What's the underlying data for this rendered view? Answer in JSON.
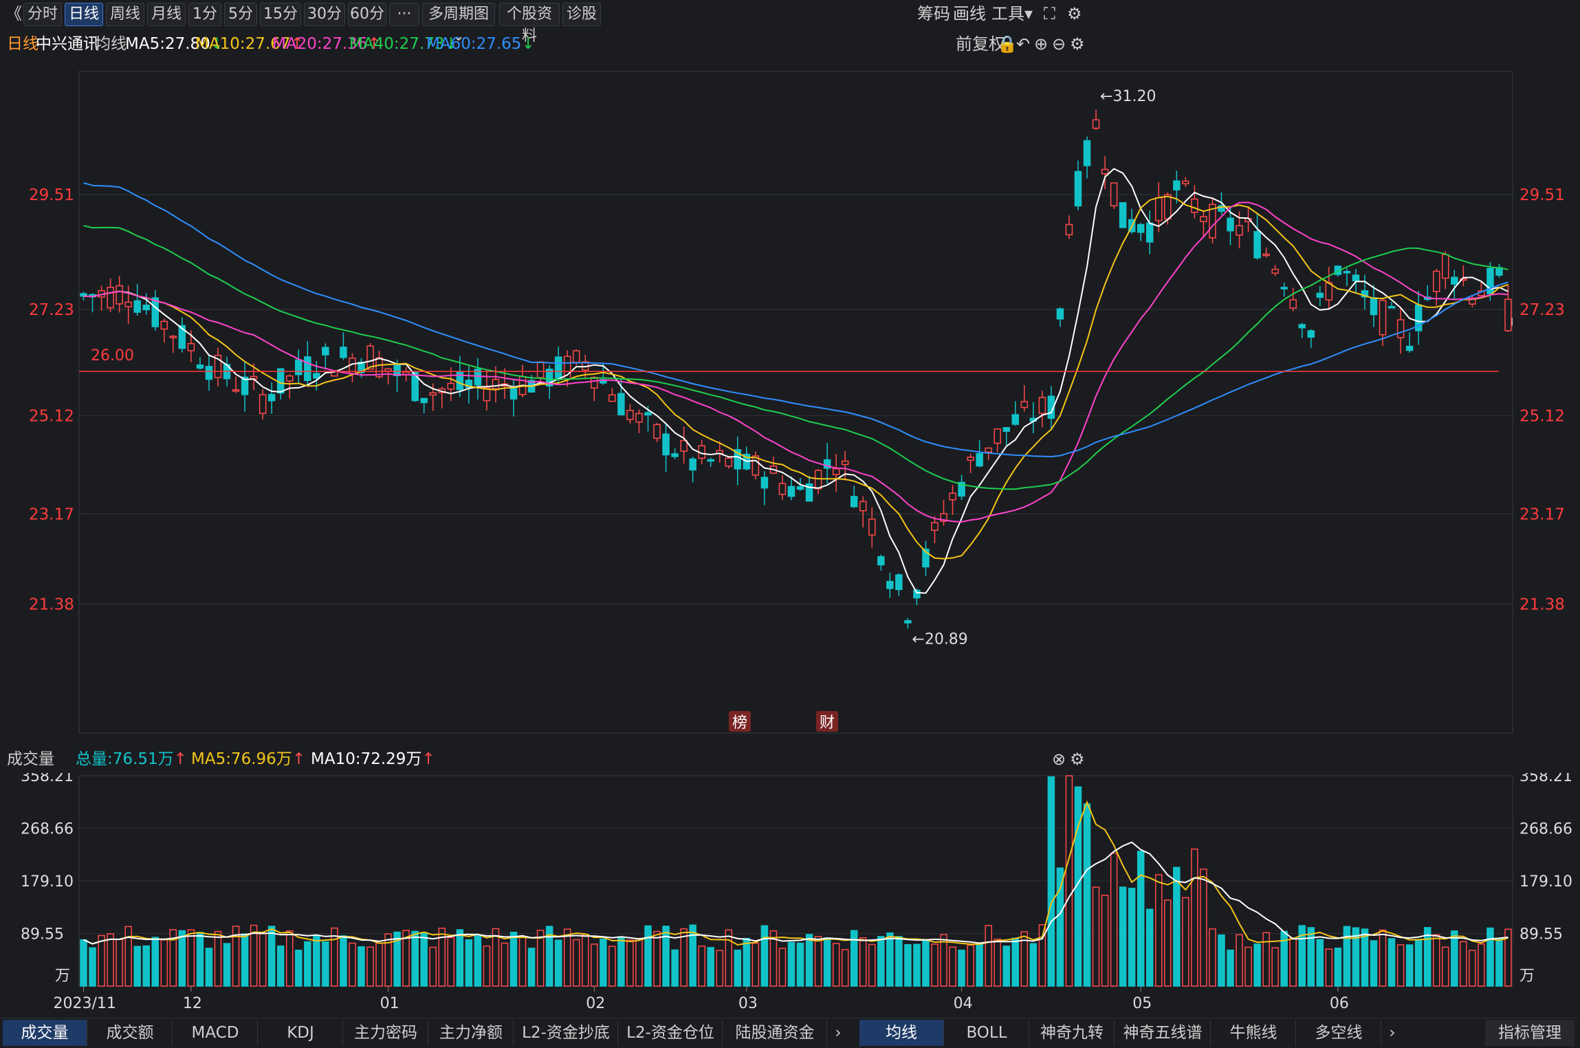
{
  "toolbar": {
    "back_icon": "double-chevron-left-icon",
    "periods": [
      "分时",
      "日线",
      "周线",
      "月线",
      "1分",
      "5分",
      "15分",
      "30分",
      "60分",
      "···"
    ],
    "active_period": "日线",
    "multi_period": "多周期图",
    "stock_info": "个股资料",
    "diagnose": "诊股",
    "right": [
      "筹码",
      "画线",
      "工具"
    ]
  },
  "legend": {
    "period": "日线",
    "stock": "中兴通讯",
    "ma_label": "均线",
    "ma5": "MA5:27.80",
    "ma10": "MA10:27.67",
    "ma20": "MA20:27.36",
    "ma40": "MA40:27.73",
    "ma60": "MA60:27.65",
    "adjust": "前复权"
  },
  "colors": {
    "up": "#ff4a4a",
    "down": "#11c3c9",
    "ma5": "#ffffff",
    "ma10": "#f5c518",
    "ma20": "#ff44cc",
    "ma40": "#1fcf4f",
    "ma60": "#2f8fff",
    "axis_red": "#ff3b3b"
  },
  "price_axis": [
    "29.51",
    "27.23",
    "25.12",
    "23.17",
    "21.38"
  ],
  "marks": {
    "high": "←31.20",
    "low": "←20.89",
    "level": "26.00",
    "badge1": "榜",
    "badge2": "财"
  },
  "volume": {
    "title": "成交量",
    "total": "总量:76.51万",
    "ma5": "MA5:76.96万",
    "ma10": "MA10:72.29万",
    "axis": [
      "358.21",
      "268.66",
      "179.10",
      "89.55"
    ],
    "unit": "万"
  },
  "dates": [
    "2023/11",
    "12",
    "01",
    "02",
    "03",
    "04",
    "05",
    "06"
  ],
  "bottom_tabs": [
    "成交量",
    "成交额",
    "MACD",
    "KDJ",
    "主力密码",
    "主力净额",
    "L2-资金抄底",
    "L2-资金仓位",
    "陆股通资金"
  ],
  "bottom_tabs2": [
    "均线",
    "BOLL",
    "神奇九转",
    "神奇五线谱",
    "牛熊线",
    "多空线"
  ],
  "indicator_mgmt": "指标管理",
  "chart_data": {
    "type": "candlestick",
    "title": "中兴通讯 日线",
    "y_range": [
      20.3,
      31.8
    ],
    "high": 31.2,
    "low": 20.89,
    "reference_line": 26.0,
    "ma_latest": {
      "MA5": 27.8,
      "MA10": 27.67,
      "MA20": 27.36,
      "MA40": 27.73,
      "MA60": 27.65
    },
    "volume_latest_wan": 76.51,
    "volume_ma_wan": {
      "MA5": 76.96,
      "MA10": 72.29
    }
  }
}
